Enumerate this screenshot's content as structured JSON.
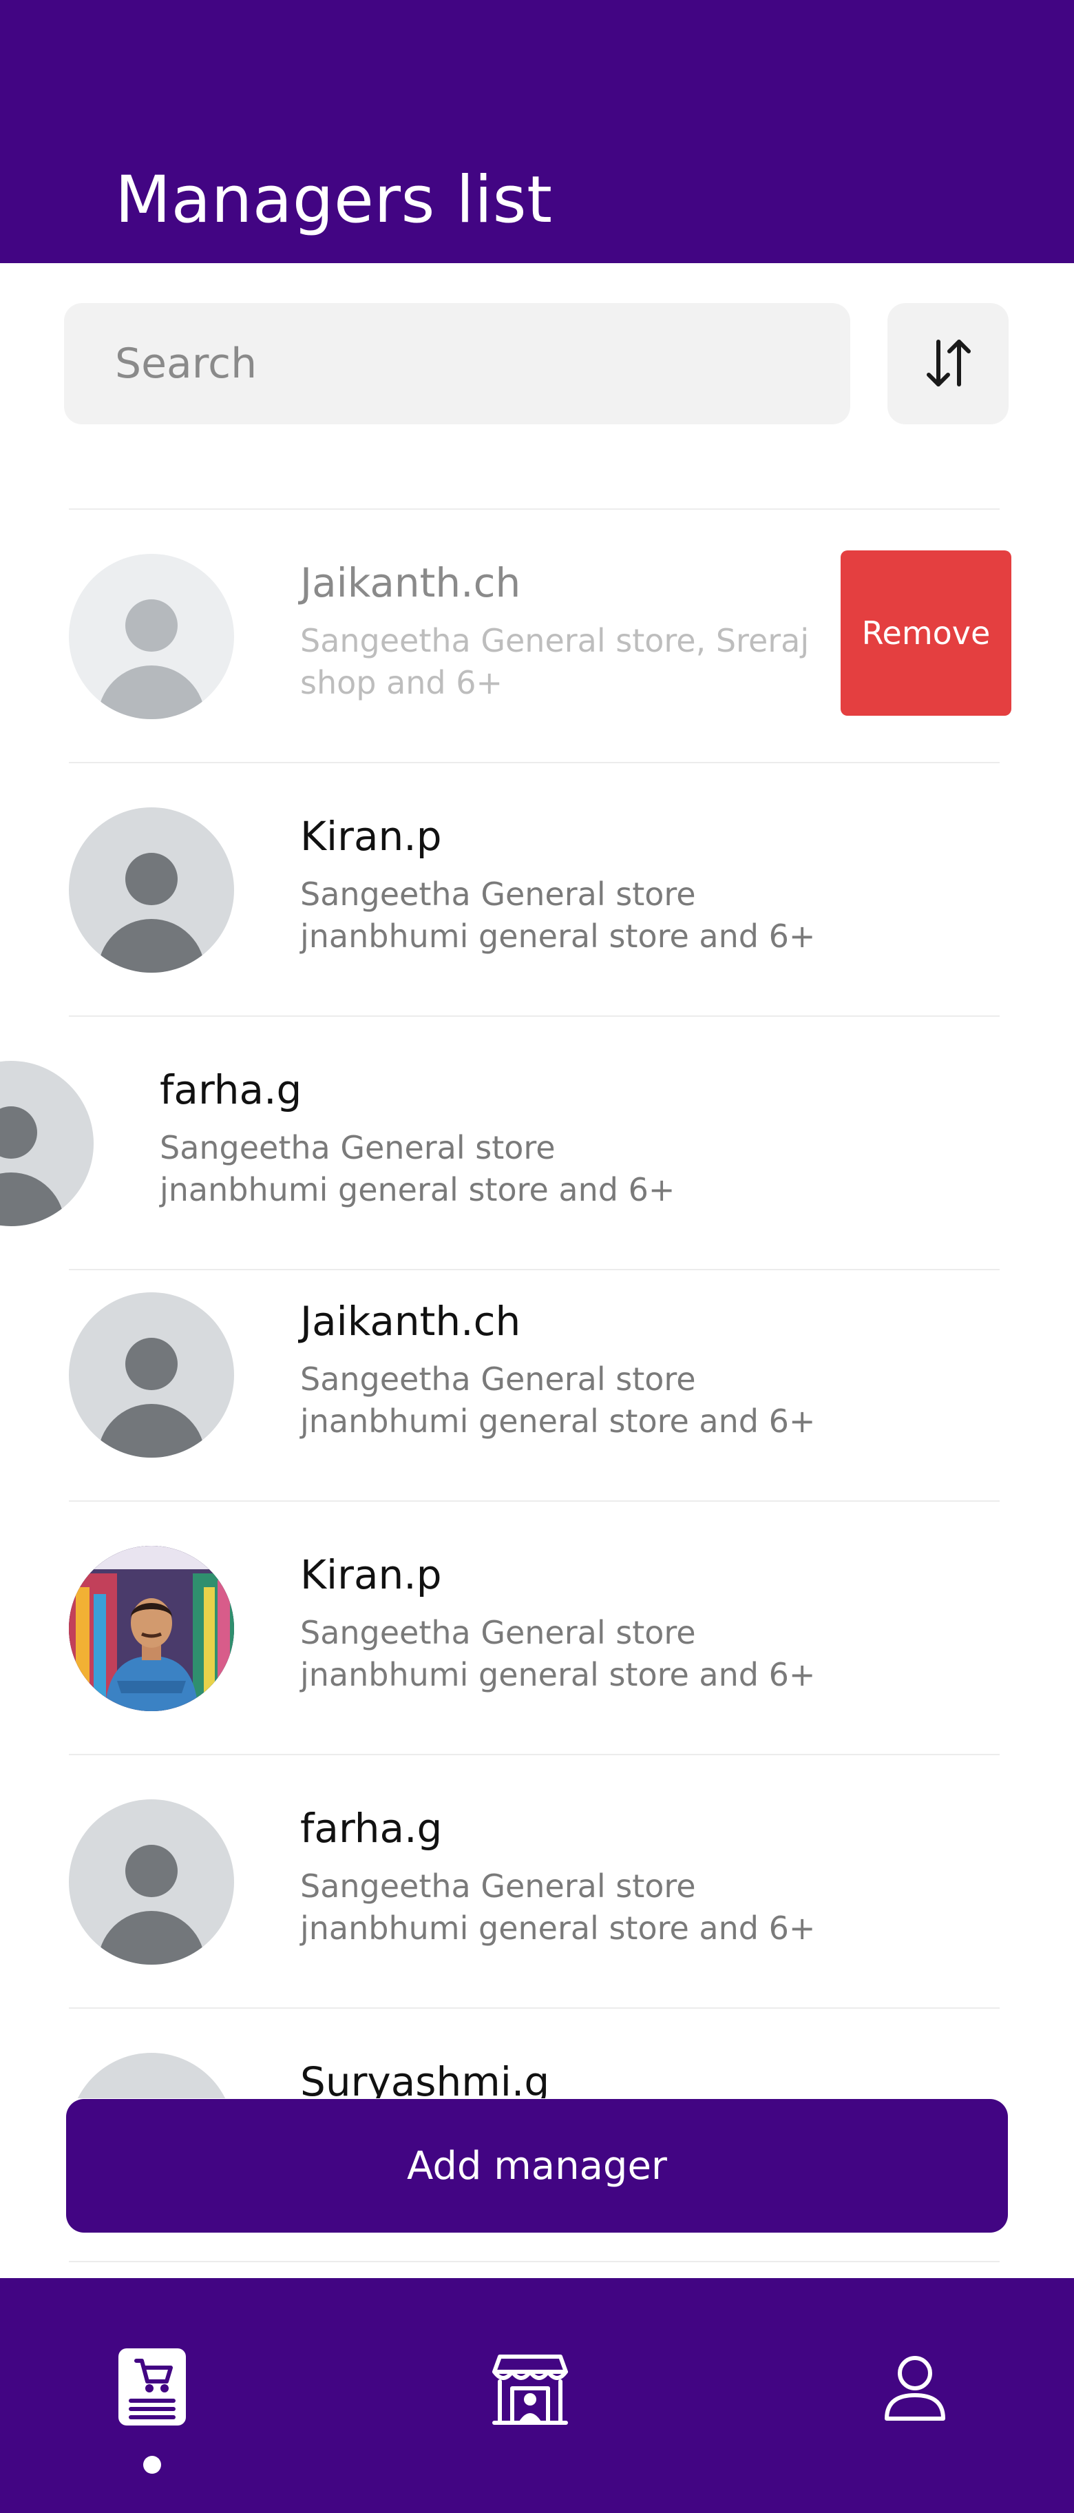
{
  "header": {
    "title": "Managers list"
  },
  "search": {
    "placeholder": "Search"
  },
  "managers": [
    {
      "name": "Jaikanth.ch",
      "stores_line1": "Sangeetha General store, Sreraj",
      "stores_line2": "shop and 6+",
      "avatar": "placeholder"
    },
    {
      "name": "Kiran.p",
      "stores_line1": "Sangeetha General store",
      "stores_line2": "jnanbhumi general store  and 6+",
      "avatar": "placeholder"
    },
    {
      "name": "farha.g",
      "stores_line1": "Sangeetha General store",
      "stores_line2": "jnanbhumi general store  and 6+",
      "avatar": "placeholder"
    },
    {
      "name": "Jaikanth.ch",
      "stores_line1": "Sangeetha General store",
      "stores_line2": "jnanbhumi general store  and 6+",
      "avatar": "placeholder"
    },
    {
      "name": "Kiran.p",
      "stores_line1": "Sangeetha General store",
      "stores_line2": "jnanbhumi general store  and 6+",
      "avatar": "photo"
    },
    {
      "name": "farha.g",
      "stores_line1": "Sangeetha General store",
      "stores_line2": "jnanbhumi general store  and 6+",
      "avatar": "placeholder"
    },
    {
      "name": "Suryashmi.g",
      "avatar": "placeholder"
    }
  ],
  "remove_label": "Remove",
  "add_manager_label": "Add manager",
  "nav": {
    "items": [
      {
        "icon": "cart-document-icon",
        "active": true
      },
      {
        "icon": "store-person-icon",
        "active": false
      },
      {
        "icon": "user-profile-icon",
        "active": false
      }
    ]
  },
  "colors": {
    "primary": "#420583",
    "remove": "#e43f40",
    "search_bg": "#f2f2f2",
    "text_secondary": "#7a7a7a"
  }
}
